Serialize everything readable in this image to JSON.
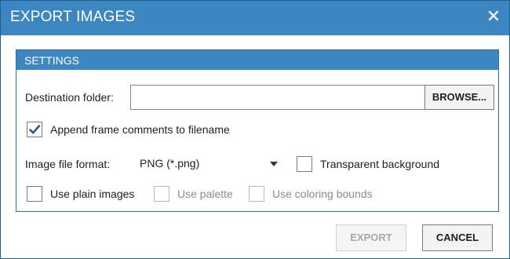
{
  "dialog": {
    "title": "EXPORT IMAGES",
    "close_icon": "close-icon",
    "accent_color": "#3c87c2"
  },
  "settings": {
    "header": "SETTINGS",
    "destination_label": "Destination folder:",
    "destination_value": "",
    "browse_label": "BROWSE...",
    "append_comments": {
      "label": "Append frame comments to filename",
      "checked": true
    },
    "format_label": "Image file format:",
    "format_value": "PNG (*.png)",
    "transparent_bg": {
      "label": "Transparent background",
      "checked": false
    },
    "plain_images": {
      "label": "Use plain images",
      "checked": false,
      "enabled": true
    },
    "use_palette": {
      "label": "Use palette",
      "checked": false,
      "enabled": false
    },
    "coloring_bounds": {
      "label": "Use coloring bounds",
      "checked": false,
      "enabled": false
    }
  },
  "footer": {
    "export_label": "EXPORT",
    "export_enabled": false,
    "cancel_label": "CANCEL"
  }
}
